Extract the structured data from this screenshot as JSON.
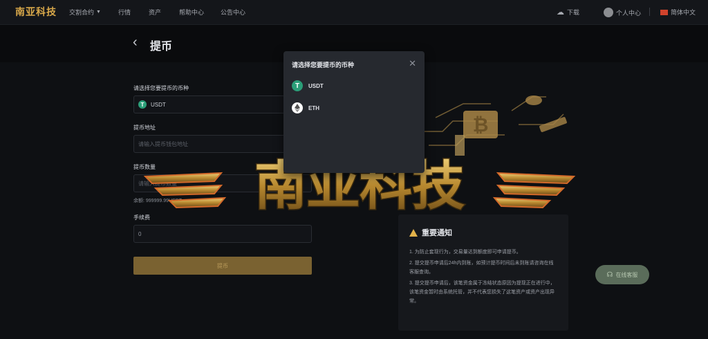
{
  "nav": {
    "logo": "南亚科技",
    "items": [
      "交割合约",
      "行情",
      "资产",
      "帮助中心",
      "公告中心"
    ],
    "download": "下载",
    "user_center": "个人中心",
    "language": "简体中文"
  },
  "page": {
    "title": "提币"
  },
  "form": {
    "coin_label": "请选择您要提币的币种",
    "coin_value": "USDT",
    "address_label": "提币地址",
    "address_placeholder": "请输入提币钱包地址",
    "amount_label": "提币数量",
    "amount_placeholder": "请输入提币数量",
    "balance": "余额: 999999.99USDT",
    "fee_label": "手续费",
    "fee_value": "0",
    "submit": "提币"
  },
  "notice": {
    "title": "重要通知",
    "lines": [
      "1. 为防止套现行为，交易量达到额度即可申请提币。",
      "2. 提交提币申请后24h内到账，如预计提币时间后未到账请咨询在线客服查询。",
      "3. 提交提币申请后，该笔资金属于冻结状态原因为提现正在进行中，该笔资金暂时由系统托管，并不代表您损失了这笔资产或资产出现异常。"
    ]
  },
  "support": "在线客服",
  "watermark": "南亚科技",
  "modal": {
    "title": "请选择您要提币的币种",
    "options": [
      "USDT",
      "ETH"
    ]
  },
  "colors": {
    "accent": "#d8a84a",
    "usdt": "#2b9e78",
    "submit_bg": "#7a6231"
  }
}
